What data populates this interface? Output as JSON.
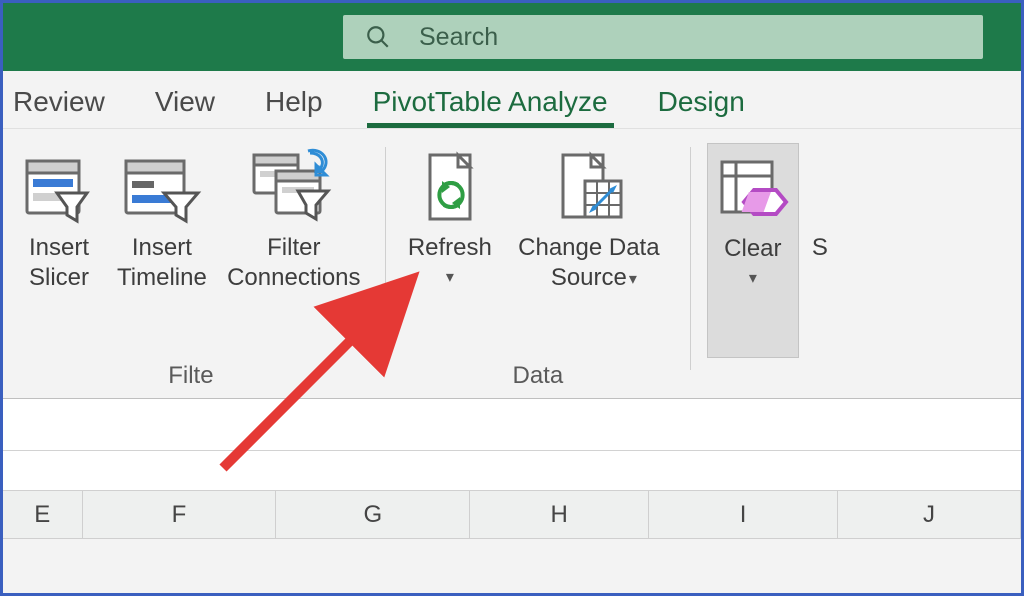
{
  "search": {
    "placeholder": "Search"
  },
  "tabs": {
    "review": "Review",
    "view": "View",
    "help": "Help",
    "analyze": "PivotTable Analyze",
    "design": "Design"
  },
  "ribbon": {
    "filter": {
      "group_label": "Filte",
      "insert_slicer": "Insert\nSlicer",
      "insert_timeline": "Insert\nTimeline",
      "filter_connections": "Filter\nConnections"
    },
    "data": {
      "group_label": "Data",
      "refresh": "Refresh",
      "change_source": "Change Data\nSource"
    },
    "actions": {
      "clear": "Clear"
    }
  },
  "columns": [
    "E",
    "F",
    "G",
    "H",
    "I",
    "J"
  ]
}
